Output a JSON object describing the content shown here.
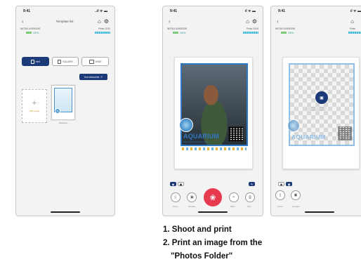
{
  "phone1": {
    "time": "9:41",
    "signal": "..ıl ᯤ ▬",
    "title": "Template list",
    "device_id": "INSTAX-000000000",
    "battery": "100%",
    "prints_label": "Prints",
    "prints_value": "10/10",
    "tabs": [
      {
        "label": "mini",
        "icon": "phone-icon"
      },
      {
        "label": "SQUARE",
        "icon": "square-icon"
      },
      {
        "label": "WIDE",
        "icon": "wide-icon"
      }
    ],
    "sort_label": "Sort viewed list",
    "add_label": "Add a new",
    "template_caption": "Aquarium"
  },
  "phone2": {
    "time": "9:41",
    "device_id": "INSTAX-000000000",
    "battery": "100%",
    "prints_label": "Prints",
    "prints_value": "10/10",
    "frame_title": "AQUARIUM",
    "frame_subtitle": "Enjoy the underwater world",
    "toggle": [
      "◉",
      "▣"
    ],
    "buttons": [
      "Frame",
      "Template",
      "Effect",
      "Print"
    ]
  },
  "phone3": {
    "time": "9:41",
    "device_id": "INSTAX-000000000",
    "battery": "100%",
    "prints_label": "Prints",
    "select_label": "Select a photo",
    "frame_title": "AQUARIUM",
    "toggle": [
      "◉",
      "▣"
    ],
    "buttons": [
      "Frame",
      "Template"
    ]
  },
  "steps": [
    "1. Shoot and print",
    "2. Print an image from the",
    "\"Photos Folder\""
  ],
  "colors": {
    "accent": "#1d3a78",
    "shutter": "#e73a4e",
    "frame_blue": "#2f78c4"
  }
}
